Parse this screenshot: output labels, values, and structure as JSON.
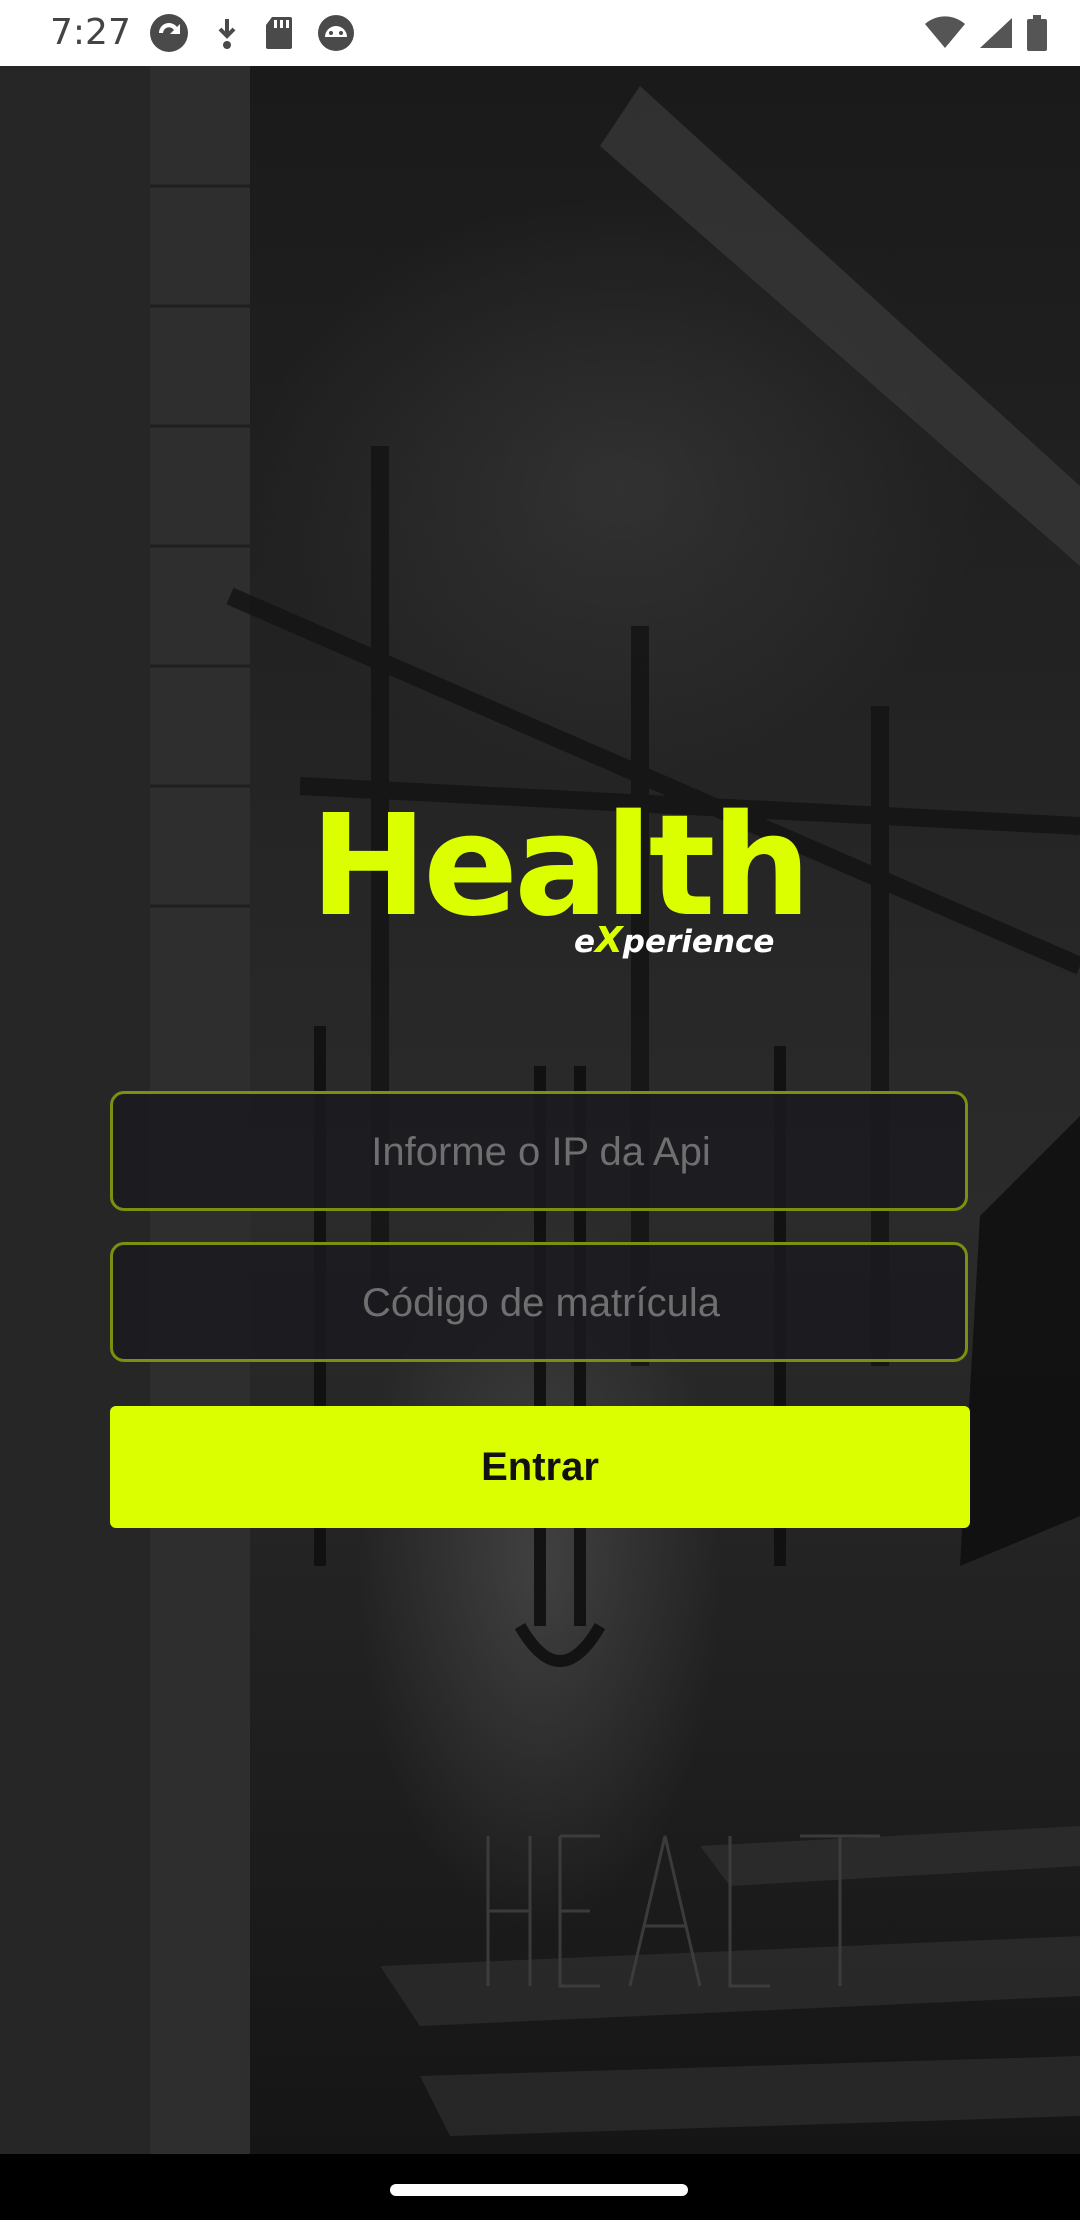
{
  "status_bar": {
    "time": "7:27",
    "left_icons": [
      "sync-app-icon",
      "download-icon",
      "sd-card-icon",
      "android-debug-icon"
    ],
    "right_icons": [
      "wifi-icon",
      "cell-signal-icon",
      "battery-icon"
    ]
  },
  "logo": {
    "title": "Health",
    "subtitle_prefix": "e",
    "subtitle_accent": "X",
    "subtitle_suffix": "perience"
  },
  "form": {
    "api_ip": {
      "placeholder": "Informe o IP da Api",
      "value": ""
    },
    "registration_code": {
      "placeholder": "Código de matrícula",
      "value": ""
    },
    "submit_label": "Entrar"
  },
  "colors": {
    "accent": "#dcff00",
    "field_border": "#7b8f10",
    "field_background": "#1a1a20",
    "background": "#1f1f1f"
  }
}
